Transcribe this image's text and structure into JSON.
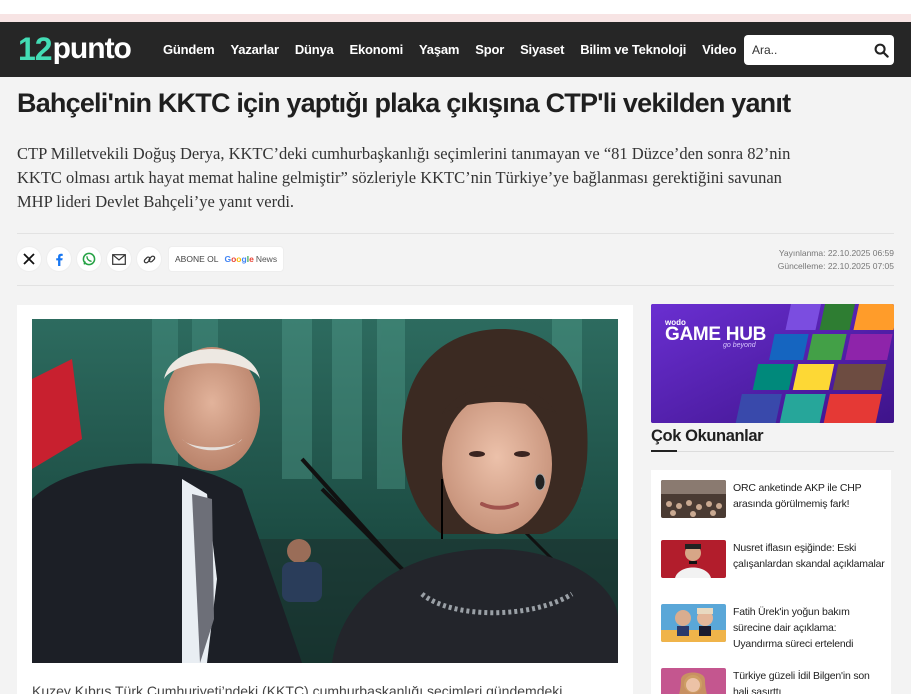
{
  "brand": {
    "num": "12",
    "word": "punto"
  },
  "nav": [
    "Gündem",
    "Yazarlar",
    "Dünya",
    "Ekonomi",
    "Yaşam",
    "Spor",
    "Siyaset",
    "Bilim ve Teknoloji",
    "Video"
  ],
  "search": {
    "placeholder": "Ara.."
  },
  "article": {
    "headline": "Bahçeli'nin KKTC için yaptığı plaka çıkışına CTP'li vekilden yanıt",
    "summary": "CTP Milletvekili Doğuş Derya, KKTC’deki cumhurbaşkanlığı seçimlerini tanımayan ve “81 Düzce’den sonra 82’nin KKTC olması artık hayat memat haline gelmiştir” sözleriyle KKTC’nin Türkiye’ye bağlanması gerektiğini savunan MHP lideri Devlet Bahçeli’ye yanıt verdi.",
    "body_start": "Kuzey Kıbrıs Türk Cumhuriyeti’ndeki (KKTC) cumhurbaşkanlığı seçimleri gündemdeki",
    "published": "Yayınlanma: 22.10.2025 06:59",
    "updated": "Güncelleme: 22.10.2025 07:05"
  },
  "share": {
    "icons": [
      "x-icon",
      "facebook-icon",
      "whatsapp-icon",
      "email-icon",
      "link-icon"
    ],
    "subscribe_label": "ABONE OL",
    "google_news_word": "Google",
    "google_news_suffix": "News"
  },
  "ad": {
    "brand": "wodo",
    "title": "GAME HUB",
    "tagline": "go beyond"
  },
  "most_read": {
    "title": "Çok Okunanlar",
    "items": [
      {
        "title": "ORC anketinde AKP ile CHP arasında görülmemiş fark!"
      },
      {
        "title": "Nusret iflasın eşiğinde: Eski çalışanlardan skandal açıklamalar"
      },
      {
        "title": "Fatih Ürek'in yoğun bakım sürecine dair açıklama: Uyandırma süreci ertelendi"
      },
      {
        "title": "Türkiye güzeli İdil Bilgen'in son hali şaşırttı"
      }
    ]
  },
  "colors": {
    "navbar": "#262626",
    "logo_accent": "#43dcb5",
    "ad_bg": "#5a23b6"
  }
}
